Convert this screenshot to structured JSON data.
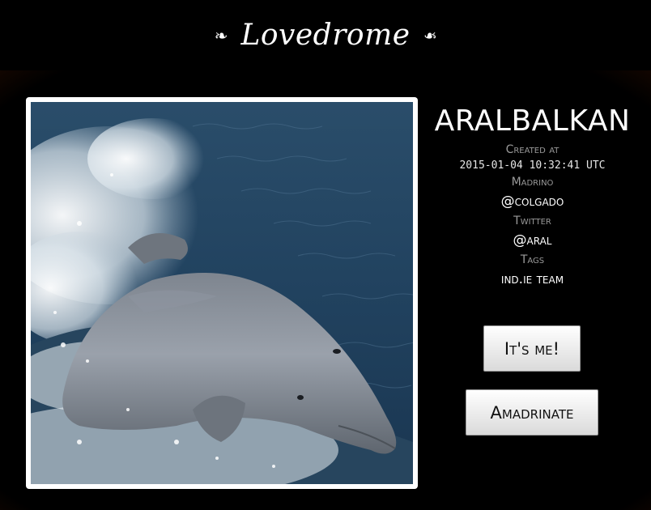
{
  "header": {
    "title": "Lovedrome",
    "ornament_left": "❧",
    "ornament_right": "❧"
  },
  "profile": {
    "username": "ARALBALKAN",
    "photo_subject": "dolphin",
    "created_at_label": "Created at",
    "created_at": "2015-01-04 10:32:41 UTC",
    "madrino_label": "Madrino",
    "madrino": "@colgado",
    "twitter_label": "Twitter",
    "twitter": "@aral",
    "tags_label": "Tags",
    "tags": "ind.ie team"
  },
  "actions": {
    "its_me": "It's me!",
    "amadrinate": "Amadrinate"
  },
  "colors": {
    "header_bg": "#000000",
    "glow": "#552000",
    "text": "#ffffff",
    "label": "#9a9a9a"
  }
}
